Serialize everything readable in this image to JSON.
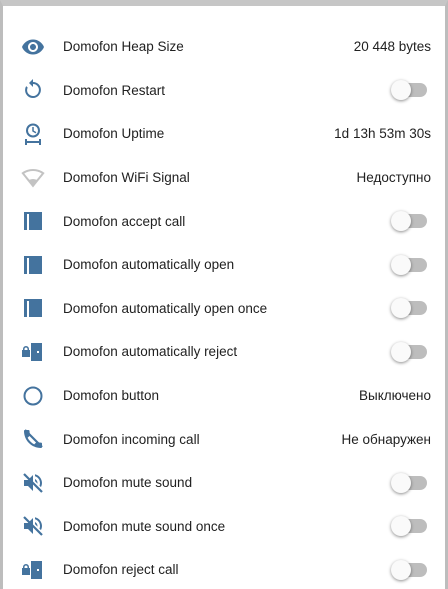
{
  "entities": [
    {
      "icon": "eye-icon",
      "label": "Domofon Heap Size",
      "type": "value",
      "value": "20 448 bytes"
    },
    {
      "icon": "restart-icon",
      "label": "Domofon Restart",
      "type": "toggle",
      "state": "off"
    },
    {
      "icon": "timer-icon",
      "label": "Domofon Uptime",
      "type": "value",
      "value": "1d 13h 53m 30s"
    },
    {
      "icon": "wifi-icon",
      "label": "Domofon WiFi Signal",
      "type": "value",
      "value": "Недоступно"
    },
    {
      "icon": "door-icon",
      "label": "Domofon accept call",
      "type": "toggle",
      "state": "off"
    },
    {
      "icon": "door-icon",
      "label": "Domofon automatically open",
      "type": "toggle",
      "state": "off"
    },
    {
      "icon": "door-icon",
      "label": "Domofon automatically open once",
      "type": "toggle",
      "state": "off"
    },
    {
      "icon": "door-lock-icon",
      "label": "Domofon automatically reject",
      "type": "toggle",
      "state": "off"
    },
    {
      "icon": "circle-icon",
      "label": "Domofon button",
      "type": "value",
      "value": "Выключено"
    },
    {
      "icon": "phone-off-icon",
      "label": "Domofon incoming call",
      "type": "value",
      "value": "Не обнаружен"
    },
    {
      "icon": "volume-off-icon",
      "label": "Domofon mute sound",
      "type": "toggle",
      "state": "off"
    },
    {
      "icon": "volume-off-icon",
      "label": "Domofon mute sound once",
      "type": "toggle",
      "state": "off"
    },
    {
      "icon": "door-lock-icon",
      "label": "Domofon reject call",
      "type": "toggle",
      "state": "off"
    }
  ],
  "colors": {
    "icon_blue": "#44739e",
    "icon_disabled": "#bdbdbd",
    "text": "#212121",
    "toggle_track_off": "#bdbdbd",
    "toggle_thumb_off": "#fafafa"
  }
}
